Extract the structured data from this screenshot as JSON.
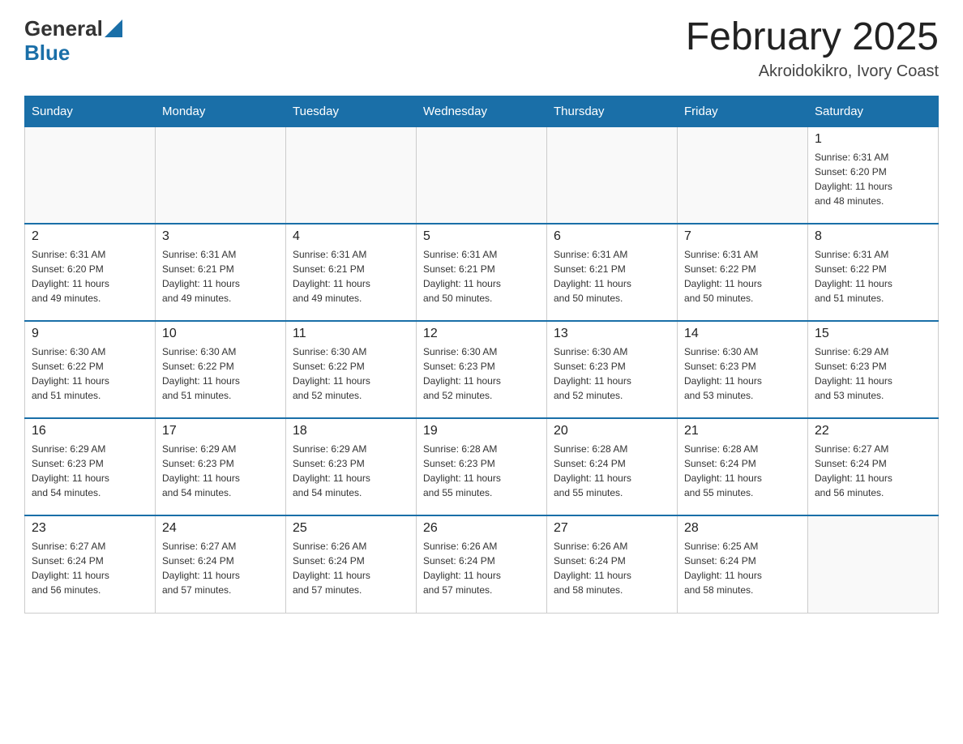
{
  "header": {
    "logo_general": "General",
    "logo_blue": "Blue",
    "month_title": "February 2025",
    "location": "Akroidokikro, Ivory Coast"
  },
  "days_of_week": [
    "Sunday",
    "Monday",
    "Tuesday",
    "Wednesday",
    "Thursday",
    "Friday",
    "Saturday"
  ],
  "weeks": [
    {
      "days": [
        {
          "number": "",
          "info": "",
          "empty": true
        },
        {
          "number": "",
          "info": "",
          "empty": true
        },
        {
          "number": "",
          "info": "",
          "empty": true
        },
        {
          "number": "",
          "info": "",
          "empty": true
        },
        {
          "number": "",
          "info": "",
          "empty": true
        },
        {
          "number": "",
          "info": "",
          "empty": true
        },
        {
          "number": "1",
          "info": "Sunrise: 6:31 AM\nSunset: 6:20 PM\nDaylight: 11 hours\nand 48 minutes.",
          "empty": false
        }
      ]
    },
    {
      "days": [
        {
          "number": "2",
          "info": "Sunrise: 6:31 AM\nSunset: 6:20 PM\nDaylight: 11 hours\nand 49 minutes.",
          "empty": false
        },
        {
          "number": "3",
          "info": "Sunrise: 6:31 AM\nSunset: 6:21 PM\nDaylight: 11 hours\nand 49 minutes.",
          "empty": false
        },
        {
          "number": "4",
          "info": "Sunrise: 6:31 AM\nSunset: 6:21 PM\nDaylight: 11 hours\nand 49 minutes.",
          "empty": false
        },
        {
          "number": "5",
          "info": "Sunrise: 6:31 AM\nSunset: 6:21 PM\nDaylight: 11 hours\nand 50 minutes.",
          "empty": false
        },
        {
          "number": "6",
          "info": "Sunrise: 6:31 AM\nSunset: 6:21 PM\nDaylight: 11 hours\nand 50 minutes.",
          "empty": false
        },
        {
          "number": "7",
          "info": "Sunrise: 6:31 AM\nSunset: 6:22 PM\nDaylight: 11 hours\nand 50 minutes.",
          "empty": false
        },
        {
          "number": "8",
          "info": "Sunrise: 6:31 AM\nSunset: 6:22 PM\nDaylight: 11 hours\nand 51 minutes.",
          "empty": false
        }
      ]
    },
    {
      "days": [
        {
          "number": "9",
          "info": "Sunrise: 6:30 AM\nSunset: 6:22 PM\nDaylight: 11 hours\nand 51 minutes.",
          "empty": false
        },
        {
          "number": "10",
          "info": "Sunrise: 6:30 AM\nSunset: 6:22 PM\nDaylight: 11 hours\nand 51 minutes.",
          "empty": false
        },
        {
          "number": "11",
          "info": "Sunrise: 6:30 AM\nSunset: 6:22 PM\nDaylight: 11 hours\nand 52 minutes.",
          "empty": false
        },
        {
          "number": "12",
          "info": "Sunrise: 6:30 AM\nSunset: 6:23 PM\nDaylight: 11 hours\nand 52 minutes.",
          "empty": false
        },
        {
          "number": "13",
          "info": "Sunrise: 6:30 AM\nSunset: 6:23 PM\nDaylight: 11 hours\nand 52 minutes.",
          "empty": false
        },
        {
          "number": "14",
          "info": "Sunrise: 6:30 AM\nSunset: 6:23 PM\nDaylight: 11 hours\nand 53 minutes.",
          "empty": false
        },
        {
          "number": "15",
          "info": "Sunrise: 6:29 AM\nSunset: 6:23 PM\nDaylight: 11 hours\nand 53 minutes.",
          "empty": false
        }
      ]
    },
    {
      "days": [
        {
          "number": "16",
          "info": "Sunrise: 6:29 AM\nSunset: 6:23 PM\nDaylight: 11 hours\nand 54 minutes.",
          "empty": false
        },
        {
          "number": "17",
          "info": "Sunrise: 6:29 AM\nSunset: 6:23 PM\nDaylight: 11 hours\nand 54 minutes.",
          "empty": false
        },
        {
          "number": "18",
          "info": "Sunrise: 6:29 AM\nSunset: 6:23 PM\nDaylight: 11 hours\nand 54 minutes.",
          "empty": false
        },
        {
          "number": "19",
          "info": "Sunrise: 6:28 AM\nSunset: 6:23 PM\nDaylight: 11 hours\nand 55 minutes.",
          "empty": false
        },
        {
          "number": "20",
          "info": "Sunrise: 6:28 AM\nSunset: 6:24 PM\nDaylight: 11 hours\nand 55 minutes.",
          "empty": false
        },
        {
          "number": "21",
          "info": "Sunrise: 6:28 AM\nSunset: 6:24 PM\nDaylight: 11 hours\nand 55 minutes.",
          "empty": false
        },
        {
          "number": "22",
          "info": "Sunrise: 6:27 AM\nSunset: 6:24 PM\nDaylight: 11 hours\nand 56 minutes.",
          "empty": false
        }
      ]
    },
    {
      "days": [
        {
          "number": "23",
          "info": "Sunrise: 6:27 AM\nSunset: 6:24 PM\nDaylight: 11 hours\nand 56 minutes.",
          "empty": false
        },
        {
          "number": "24",
          "info": "Sunrise: 6:27 AM\nSunset: 6:24 PM\nDaylight: 11 hours\nand 57 minutes.",
          "empty": false
        },
        {
          "number": "25",
          "info": "Sunrise: 6:26 AM\nSunset: 6:24 PM\nDaylight: 11 hours\nand 57 minutes.",
          "empty": false
        },
        {
          "number": "26",
          "info": "Sunrise: 6:26 AM\nSunset: 6:24 PM\nDaylight: 11 hours\nand 57 minutes.",
          "empty": false
        },
        {
          "number": "27",
          "info": "Sunrise: 6:26 AM\nSunset: 6:24 PM\nDaylight: 11 hours\nand 58 minutes.",
          "empty": false
        },
        {
          "number": "28",
          "info": "Sunrise: 6:25 AM\nSunset: 6:24 PM\nDaylight: 11 hours\nand 58 minutes.",
          "empty": false
        },
        {
          "number": "",
          "info": "",
          "empty": true
        }
      ]
    }
  ]
}
